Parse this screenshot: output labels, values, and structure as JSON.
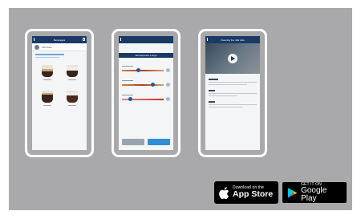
{
  "screens": [
    {
      "name": "beverages-list",
      "title": "Beverages",
      "user": "John Doe"
    },
    {
      "name": "customize-beverage",
      "title": "",
      "banner": "Set Espresso Lungo"
    },
    {
      "name": "video-tutorial",
      "title": "Cleaning the milk tube"
    }
  ],
  "store_badges": {
    "apple": {
      "small": "Download on the",
      "big": "App Store",
      "icon": "apple-icon"
    },
    "google": {
      "small": "GET IT ON",
      "big": "Google Play",
      "icon": "google-play-icon"
    }
  },
  "colors": {
    "background": "#a9a9ab",
    "app_header": "#1a3a66",
    "accent": "#2e8fd6"
  }
}
